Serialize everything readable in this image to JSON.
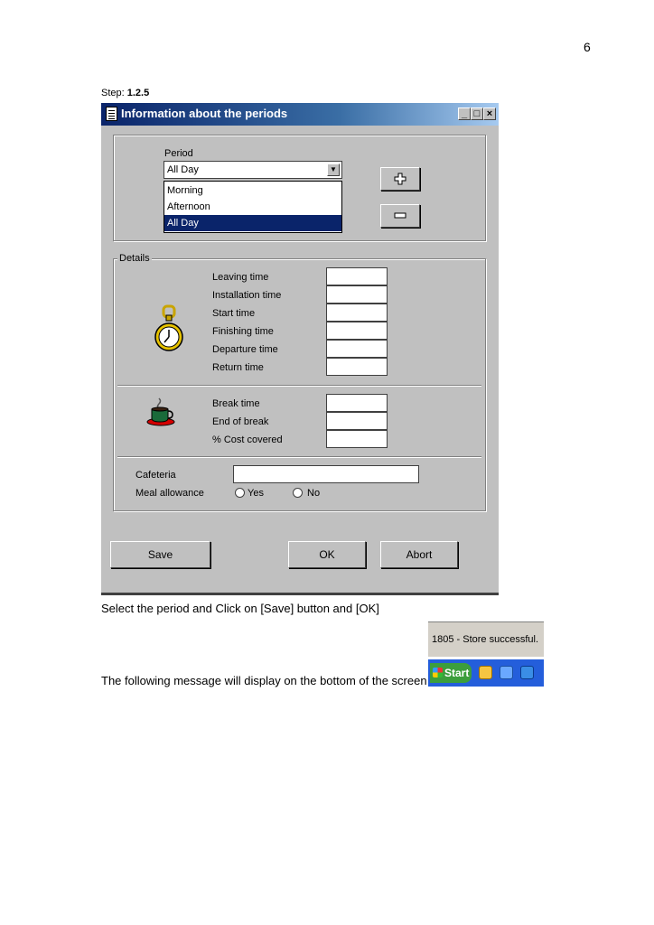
{
  "page_number": "6",
  "step": {
    "label": "Step: ",
    "value": "1.2.5"
  },
  "dialog": {
    "title": "Information about the periods",
    "period": {
      "label": "Period",
      "selected": "All Day",
      "options": [
        "Morning",
        "Afternoon",
        "All Day"
      ]
    },
    "details": {
      "legend": "Details",
      "time_fields": [
        "Leaving time",
        "Installation time",
        "Start time",
        "Finishing time",
        "Departure time",
        "Return time"
      ],
      "break_fields": [
        "Break time",
        "End of break",
        "% Cost covered"
      ],
      "cafeteria_label": "Cafeteria",
      "meal_allowance_label": "Meal allowance",
      "radio_yes": "Yes",
      "radio_no": "No"
    },
    "buttons": {
      "save": "Save",
      "ok": "OK",
      "abort": "Abort"
    }
  },
  "instruction": "Select the period and Click on [Save] button and [OK]",
  "message_intro": "The following message will display on the bottom of the screen",
  "status_message": "1805 - Store successful.",
  "taskbar": {
    "start_label": "Start"
  },
  "icons": {
    "period_add": "plus-icon",
    "period_remove": "minus-icon",
    "details_clock": "stopwatch-icon",
    "break_cup": "coffee-cup-icon"
  }
}
